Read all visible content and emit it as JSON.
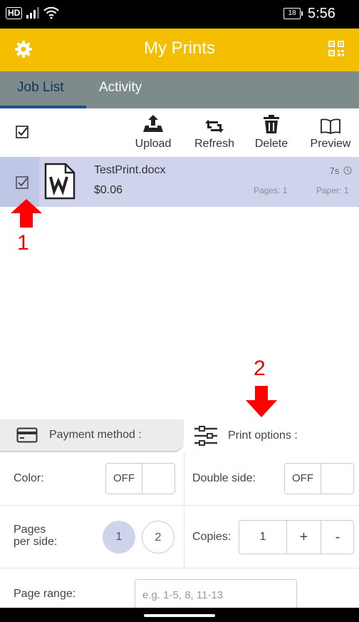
{
  "status": {
    "network": "HD",
    "battery": "18",
    "time": "5:56"
  },
  "appbar": {
    "title": "My Prints"
  },
  "tabs": [
    {
      "label": "Job List"
    },
    {
      "label": "Activity"
    }
  ],
  "toolbar": {
    "upload": "Upload",
    "refresh": "Refresh",
    "delete": "Delete",
    "preview": "Preview"
  },
  "job": {
    "filename": "TestPrint.docx",
    "price": "$0.06",
    "age": "7s",
    "pages": "Pages: 1",
    "paper": "Paper: 1"
  },
  "annotations": {
    "one": "1",
    "two": "2"
  },
  "bottom_tabs": {
    "payment": "Payment method :",
    "print_options": "Print options :"
  },
  "options": {
    "color_label": "Color:",
    "color_value": "OFF",
    "double_label": "Double side:",
    "double_value": "OFF",
    "pages_label_1": "Pages",
    "pages_label_2": "per side:",
    "pages_opt_1": "1",
    "pages_opt_2": "2",
    "copies_label": "Copies:",
    "copies_value": "1",
    "copies_plus": "+",
    "copies_minus": "-",
    "range_label": "Page range:",
    "range_placeholder": "e.g. 1-5, 8, 11-13"
  },
  "colors": {
    "appbar": "#f4bf00",
    "tabbar": "#7d8b8b",
    "selected_row": "#cfd3ec",
    "annotation": "#ff0000"
  }
}
